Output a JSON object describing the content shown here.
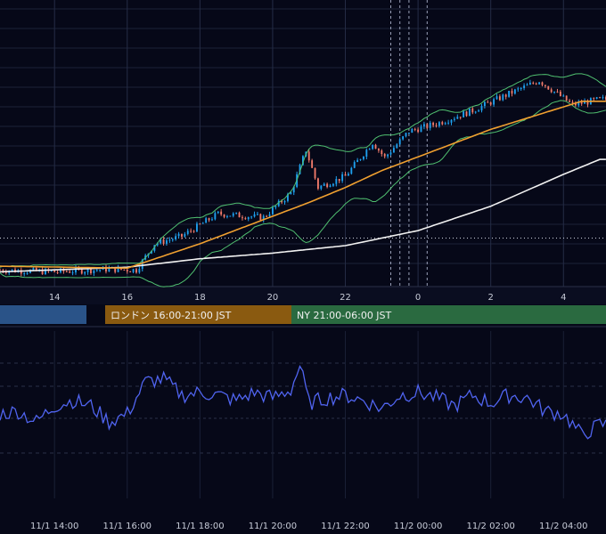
{
  "colors": {
    "background": "#060818",
    "grid": "#1c2238",
    "bullish": "#1ea0ee",
    "bearish": "#f07a6a",
    "ma_short": "#f0a030",
    "ma_long": "#f2f2f2",
    "bollinger": "#50c070",
    "oscillator": "#5064f0",
    "session_tokyo": "#2a5388",
    "session_london": "#8a5a10",
    "session_ny": "#2a6a40"
  },
  "sessions": [
    {
      "label": "",
      "color": "#2a5388"
    },
    {
      "label": "ロンドン 16:00-21:00 JST",
      "color": "#8a5a10"
    },
    {
      "label": "NY 21:00-06:00 JST",
      "color": "#2a6a40"
    }
  ],
  "chart_data": [
    {
      "type": "candlestick",
      "title": "",
      "xlabel": "",
      "ylabel": "",
      "x_tick_labels": [
        "14",
        "16",
        "18",
        "20",
        "22",
        "0",
        "2",
        "4"
      ],
      "grid": true,
      "anchors": [
        {
          "t": "12:30",
          "y": 12
        },
        {
          "t": "14:00",
          "y": 10
        },
        {
          "t": "15:30",
          "y": 13
        },
        {
          "t": "16:15",
          "y": 12
        },
        {
          "t": "16:45",
          "y": 40
        },
        {
          "t": "17:30",
          "y": 48
        },
        {
          "t": "18:30",
          "y": 72
        },
        {
          "t": "19:45",
          "y": 68
        },
        {
          "t": "20:30",
          "y": 94
        },
        {
          "t": "20:55",
          "y": 140
        },
        {
          "t": "21:15",
          "y": 100
        },
        {
          "t": "22:00",
          "y": 112
        },
        {
          "t": "22:45",
          "y": 148
        },
        {
          "t": "23:05",
          "y": 132
        },
        {
          "t": "23:45",
          "y": 160
        },
        {
          "t": "00:30",
          "y": 168
        },
        {
          "t": "01:30",
          "y": 182
        },
        {
          "t": "02:30",
          "y": 200
        },
        {
          "t": "03:20",
          "y": 214
        },
        {
          "t": "04:15",
          "y": 188
        },
        {
          "t": "05:00",
          "y": 194
        }
      ],
      "ma_short_anchors": [
        {
          "t": "12:30",
          "y": 16
        },
        {
          "t": "16:00",
          "y": 14
        },
        {
          "t": "18:00",
          "y": 40
        },
        {
          "t": "19:30",
          "y": 62
        },
        {
          "t": "21:00",
          "y": 84
        },
        {
          "t": "22:00",
          "y": 100
        },
        {
          "t": "23:00",
          "y": 118
        },
        {
          "t": "00:30",
          "y": 140
        },
        {
          "t": "02:00",
          "y": 162
        },
        {
          "t": "03:30",
          "y": 180
        },
        {
          "t": "04:30",
          "y": 192
        },
        {
          "t": "05:00",
          "y": 192
        }
      ],
      "ma_long_anchors": [
        {
          "t": "12:30",
          "y": 10
        },
        {
          "t": "16:00",
          "y": 15
        },
        {
          "t": "18:00",
          "y": 24
        },
        {
          "t": "20:00",
          "y": 30
        },
        {
          "t": "22:00",
          "y": 38
        },
        {
          "t": "00:00",
          "y": 54
        },
        {
          "t": "02:00",
          "y": 80
        },
        {
          "t": "04:00",
          "y": 114
        },
        {
          "t": "05:00",
          "y": 130
        }
      ],
      "horizontal_dotted_level": 46,
      "vertical_dotted_times": [
        "23:15",
        "23:30",
        "23:45",
        "00:15"
      ],
      "ylim": [
        0,
        300
      ]
    },
    {
      "type": "line",
      "name": "oscillator",
      "title": "",
      "xlabel": "",
      "ylabel": "",
      "x_tick_labels": [
        "11/1 14:00",
        "11/1 16:00",
        "11/1 18:00",
        "11/1 20:00",
        "11/1 22:00",
        "11/2 00:00",
        "11/2 02:00",
        "11/2 04:00"
      ],
      "grid": true,
      "ylim": [
        0,
        100
      ],
      "anchors": [
        {
          "t": "12:30",
          "y": 50
        },
        {
          "t": "13:00",
          "y": 52
        },
        {
          "t": "13:30",
          "y": 44
        },
        {
          "t": "14:00",
          "y": 56
        },
        {
          "t": "14:30",
          "y": 60
        },
        {
          "t": "15:00",
          "y": 56
        },
        {
          "t": "15:30",
          "y": 44
        },
        {
          "t": "16:00",
          "y": 50
        },
        {
          "t": "16:30",
          "y": 74
        },
        {
          "t": "17:00",
          "y": 76
        },
        {
          "t": "17:30",
          "y": 64
        },
        {
          "t": "18:00",
          "y": 66
        },
        {
          "t": "18:30",
          "y": 64
        },
        {
          "t": "19:00",
          "y": 60
        },
        {
          "t": "19:30",
          "y": 66
        },
        {
          "t": "20:00",
          "y": 62
        },
        {
          "t": "20:30",
          "y": 68
        },
        {
          "t": "20:45",
          "y": 86
        },
        {
          "t": "21:00",
          "y": 58
        },
        {
          "t": "21:30",
          "y": 62
        },
        {
          "t": "22:00",
          "y": 64
        },
        {
          "t": "22:30",
          "y": 60
        },
        {
          "t": "23:00",
          "y": 54
        },
        {
          "t": "23:30",
          "y": 64
        },
        {
          "t": "00:00",
          "y": 66
        },
        {
          "t": "00:30",
          "y": 62
        },
        {
          "t": "01:00",
          "y": 56
        },
        {
          "t": "01:30",
          "y": 64
        },
        {
          "t": "02:00",
          "y": 58
        },
        {
          "t": "02:30",
          "y": 64
        },
        {
          "t": "03:00",
          "y": 62
        },
        {
          "t": "03:30",
          "y": 52
        },
        {
          "t": "04:00",
          "y": 50
        },
        {
          "t": "04:30",
          "y": 34
        },
        {
          "t": "05:00",
          "y": 42
        }
      ]
    }
  ]
}
